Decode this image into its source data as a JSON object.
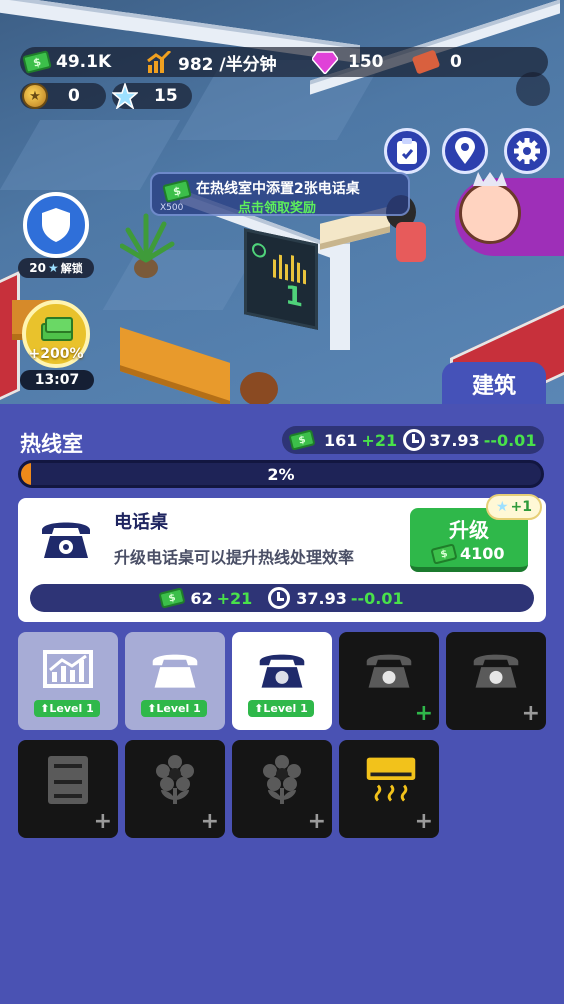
{
  "hud": {
    "cash": "49.1K",
    "income_rate": "982 /半分钟",
    "gems": "150",
    "tickets": "0",
    "badges": "0",
    "stars": "15"
  },
  "mission": {
    "text": "在热线室中添置2张电话桌",
    "action": "点击领取奖励",
    "reward": "X500"
  },
  "left_widgets": {
    "unlock_count": "20",
    "unlock_label": "解锁",
    "boost_percent": "+200%",
    "boost_timer": "13:07"
  },
  "monitor_value": "1",
  "build_tab_label": "建筑",
  "room": {
    "title": "热线室",
    "income": "161",
    "income_bonus": "+21",
    "time": "37.93",
    "time_delta": "--0.01",
    "progress_percent": 2,
    "progress_label": "2%"
  },
  "selected_item": {
    "name": "电话桌",
    "description": "升级电话桌可以提升热线处理效率",
    "upgrade_label": "升级",
    "upgrade_cost": "4100",
    "star_bonus": "+1",
    "income": "62",
    "income_bonus": "+21",
    "time": "37.93",
    "time_delta": "--0.01"
  },
  "slots": [
    {
      "icon": "chart-icon",
      "state": "unlocked",
      "level": "Level 1"
    },
    {
      "icon": "phone-icon",
      "state": "unlocked",
      "level": "Level 1"
    },
    {
      "icon": "phone-icon",
      "state": "selected",
      "level": "Level 1"
    },
    {
      "icon": "phone-icon",
      "state": "locked",
      "plus_color": "#2fb84a"
    },
    {
      "icon": "phone-icon",
      "state": "locked",
      "plus_color": "#9a9a9a"
    },
    {
      "icon": "cabinet-icon",
      "state": "locked",
      "plus_color": "#9a9a9a"
    },
    {
      "icon": "flower-icon",
      "state": "locked",
      "plus_color": "#9a9a9a"
    },
    {
      "icon": "flower-icon",
      "state": "locked",
      "plus_color": "#9a9a9a"
    },
    {
      "icon": "heater-icon",
      "state": "locked",
      "plus_color": "#9a9a9a"
    }
  ],
  "colors": {
    "panel": "#4a52b3",
    "accent_green": "#2fb84a",
    "progress": "#f08a1a"
  }
}
